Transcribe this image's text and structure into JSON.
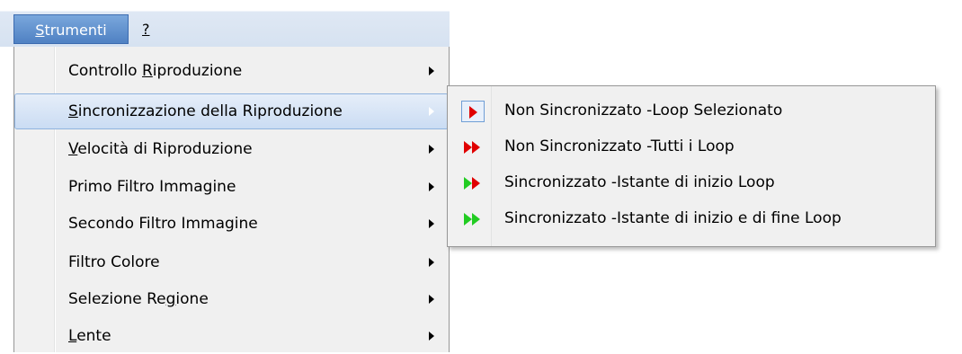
{
  "menubar": {
    "tools_label_first": "S",
    "tools_label_rest": "trumenti",
    "help_label": "?"
  },
  "menu": {
    "items": [
      {
        "pre": "Controllo ",
        "mn": "R",
        "post": "iproduzione",
        "submenu": true
      },
      {
        "pre": "",
        "mn": "S",
        "post": "incronizzazione della Riproduzione",
        "submenu": true,
        "highlighted": true
      },
      {
        "pre": "",
        "mn": "V",
        "post": "elocità di Riproduzione",
        "submenu": true
      },
      {
        "pre": "Primo Filtro Immagine",
        "mn": "",
        "post": "",
        "submenu": true
      },
      {
        "pre": "Secondo Filtro Immagine",
        "mn": "",
        "post": "",
        "submenu": true
      },
      {
        "pre": "Filtro Colore",
        "mn": "",
        "post": "",
        "submenu": true
      },
      {
        "pre": "Selezione Re",
        "mn": "g",
        "post": "ione",
        "submenu": true
      },
      {
        "pre": "",
        "mn": "L",
        "post": "ente",
        "submenu": true
      }
    ]
  },
  "submenu": {
    "items": [
      {
        "label": "Non Sincronizzato -Loop Selezionato",
        "icon": "single-red-play-icon",
        "checked": true
      },
      {
        "label": "Non Sincronizzato -Tutti i Loop",
        "icon": "double-red-play-icon"
      },
      {
        "label": "Sincronizzato -Istante di inizio Loop",
        "icon": "red-green-play-icon"
      },
      {
        "label": "Sincronizzato -Istante di inizio e di fine Loop",
        "icon": "double-green-play-icon"
      }
    ]
  },
  "colors": {
    "red": "#e00000",
    "green": "#22cc22",
    "highlight": "#cadcf3",
    "menubar_active": "#4f81c3"
  }
}
